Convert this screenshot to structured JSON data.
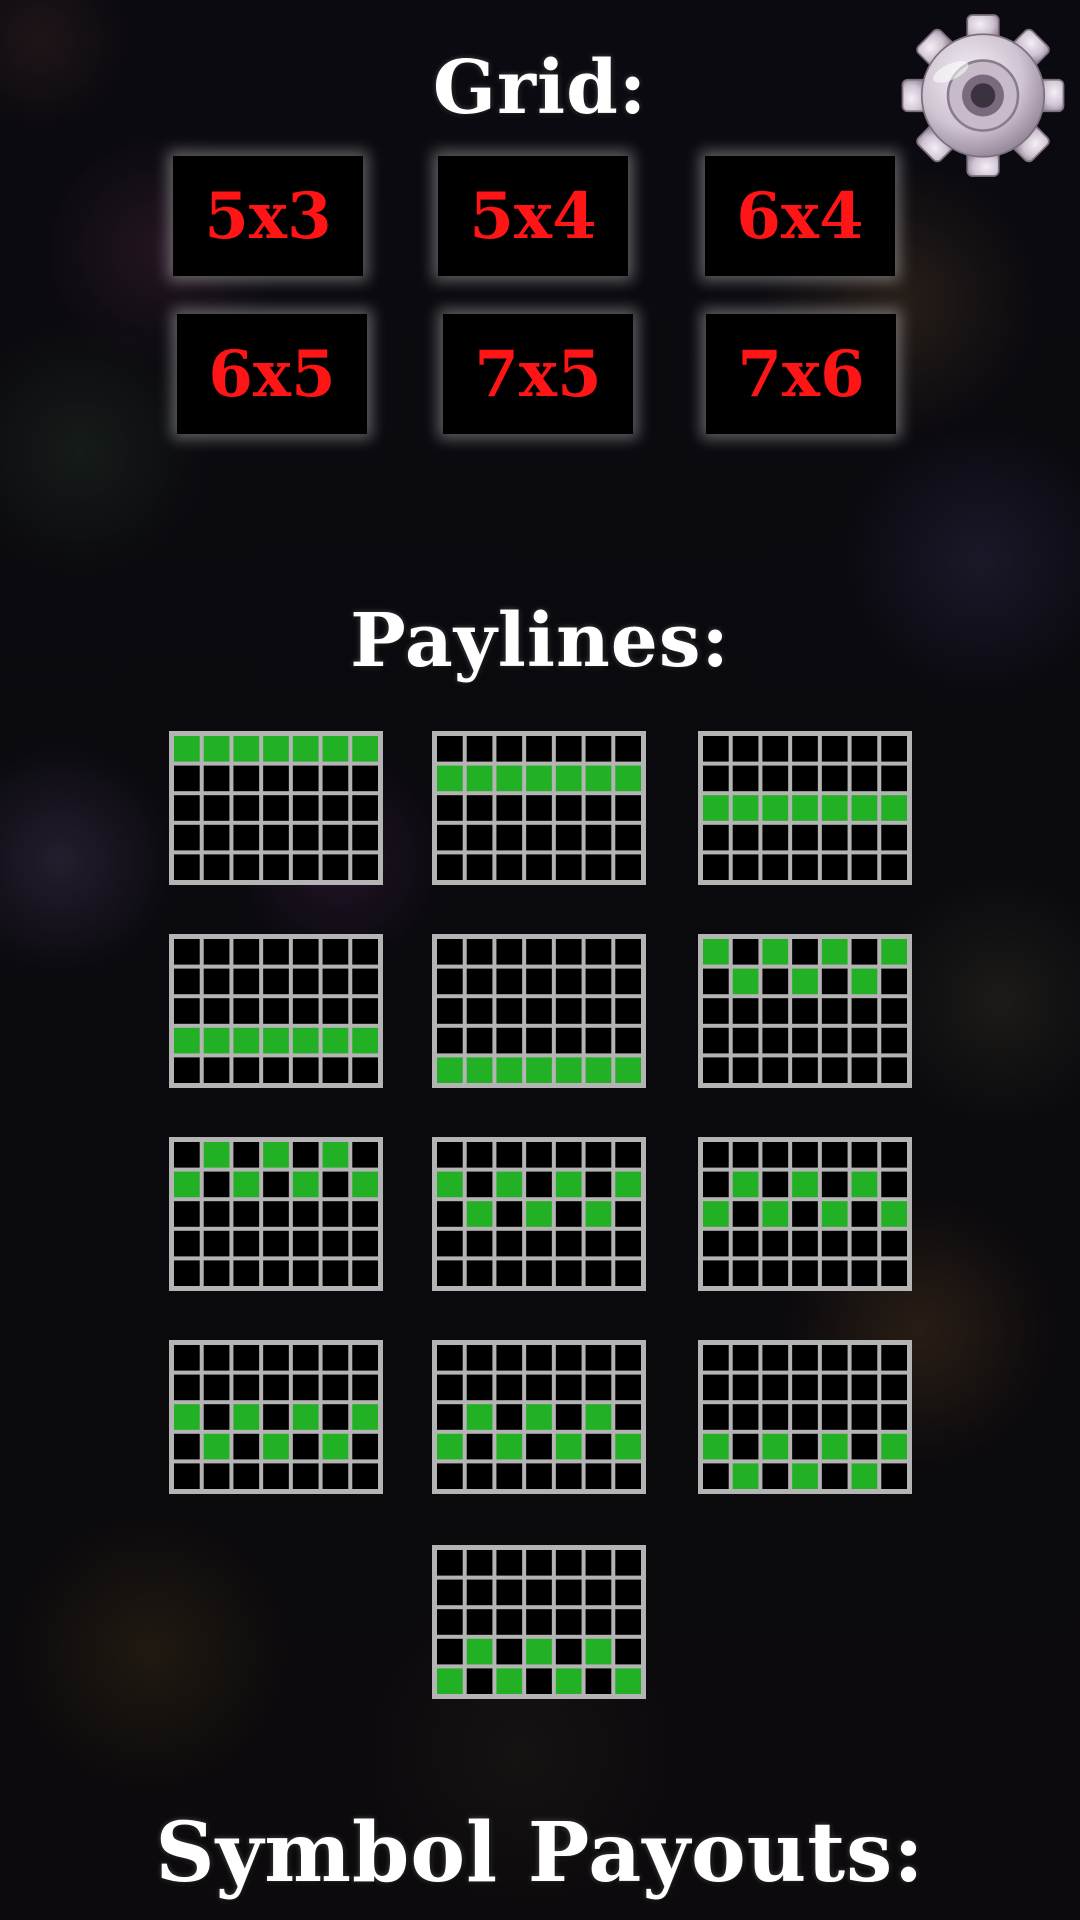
{
  "grid": {
    "title": "Grid:",
    "options": [
      "5x3",
      "5x4",
      "6x4",
      "6x5",
      "7x5",
      "7x6"
    ]
  },
  "settings": {
    "icon": "gear-icon"
  },
  "paylines": {
    "title": "Paylines:",
    "columns": 7,
    "rows": 5,
    "patterns": [
      [
        0,
        0,
        0,
        0,
        0,
        0,
        0
      ],
      [
        1,
        1,
        1,
        1,
        1,
        1,
        1
      ],
      [
        2,
        2,
        2,
        2,
        2,
        2,
        2
      ],
      [
        3,
        3,
        3,
        3,
        3,
        3,
        3
      ],
      [
        4,
        4,
        4,
        4,
        4,
        4,
        4
      ],
      [
        0,
        1,
        0,
        1,
        0,
        1,
        0
      ],
      [
        1,
        0,
        1,
        0,
        1,
        0,
        1
      ],
      [
        1,
        2,
        1,
        2,
        1,
        2,
        1
      ],
      [
        2,
        1,
        2,
        1,
        2,
        1,
        2
      ],
      [
        2,
        3,
        2,
        3,
        2,
        3,
        2
      ],
      [
        3,
        2,
        3,
        2,
        3,
        2,
        3
      ],
      [
        3,
        4,
        3,
        4,
        3,
        4,
        3
      ],
      [
        4,
        3,
        4,
        3,
        4,
        3,
        4
      ]
    ]
  },
  "symbol_payouts": {
    "title": "Symbol Payouts:"
  },
  "colors": {
    "active_cell": "#22b024",
    "cell": "#000000",
    "grid_line": "#b4b4b4",
    "grid_text": "#ff1515"
  }
}
